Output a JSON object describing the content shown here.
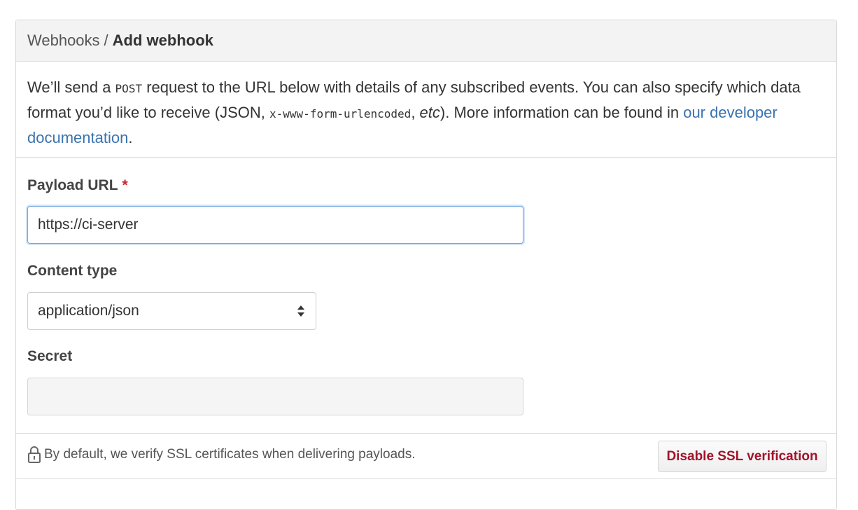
{
  "header": {
    "breadcrumb_parent": "Webhooks",
    "separator": "/",
    "breadcrumb_current": "Add webhook"
  },
  "intro": {
    "part1": "We’ll send a ",
    "code_post": "POST",
    "part2": " request to the URL below with details of any subscribed events. You can also specify which data format you’d like to receive (JSON, ",
    "code_urlencoded": "x-www-form-urlencoded",
    "part3": ", ",
    "etc": "etc",
    "part4": "). More information can be found in ",
    "link_text": "our developer documentation",
    "part5": "."
  },
  "form": {
    "payload_url": {
      "label": "Payload URL",
      "required_mark": "*",
      "value": "https://ci-server"
    },
    "content_type": {
      "label": "Content type",
      "selected": "application/json"
    },
    "secret": {
      "label": "Secret",
      "value": ""
    }
  },
  "footer": {
    "ssl_note": "By default, we verify SSL certificates when delivering payloads.",
    "disable_ssl_button": "Disable SSL verification"
  },
  "icons": {
    "lock": "lock-icon",
    "select_arrows": "chevron-up-down-icon"
  },
  "colors": {
    "link": "#3b73af",
    "required": "#cb2431",
    "danger_button_text": "#a2132b",
    "header_bg": "#f3f3f3"
  }
}
